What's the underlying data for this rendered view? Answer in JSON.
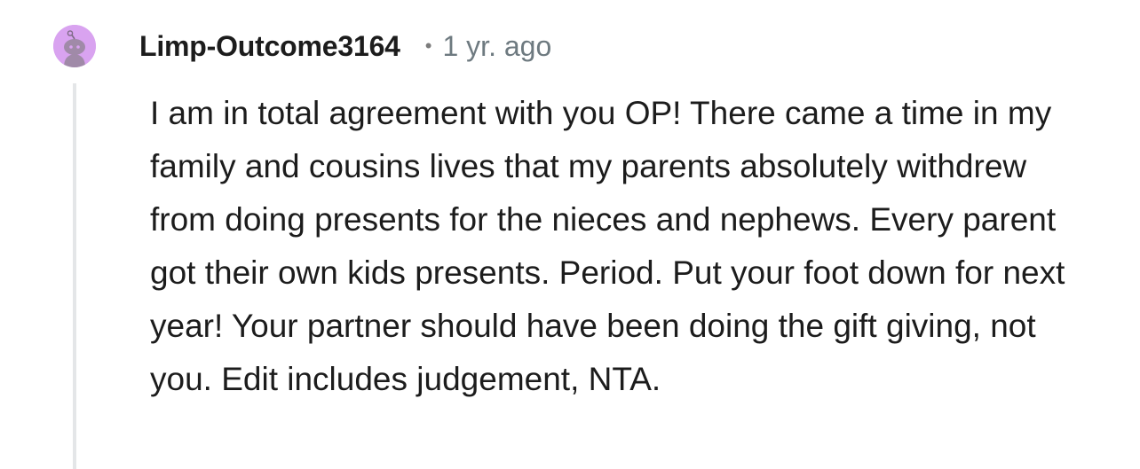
{
  "comment": {
    "author": "Limp-Outcome3164",
    "separator": "•",
    "timestamp": "1 yr. ago",
    "avatar_icon": "reddit-snoo-avatar-icon",
    "avatar_color": "#d9a3f0",
    "body": "I am in total agreement with you OP! There came a time in my family and cousins lives that my parents absolutely withdrew from doing presents for the nieces and nephews. Every parent got their own kids presents. Period. Put your foot down for next year! Your partner should have been doing the gift giving, not you. Edit includes judgement, NTA."
  }
}
